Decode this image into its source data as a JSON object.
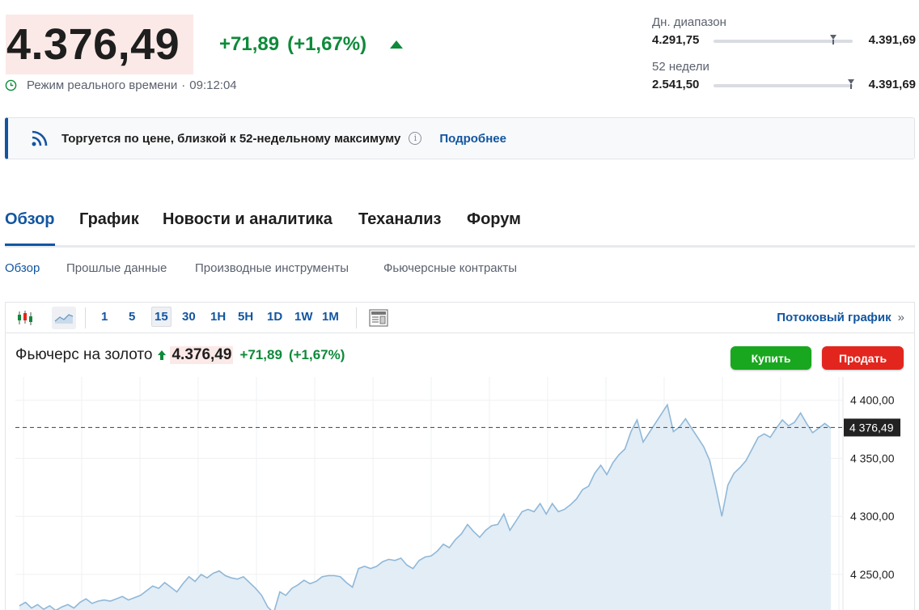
{
  "quote": {
    "price": "4.376,49",
    "change": "+71,89",
    "change_pct": "(+1,67%)",
    "realtime_label": "Режим реального времени",
    "separator": "·",
    "time": "09:12:04"
  },
  "ranges": {
    "day": {
      "label": "Дн. диапазон",
      "low": "4.291,75",
      "high": "4.391,69",
      "position": 0.86
    },
    "week52": {
      "label": "52 недели",
      "low": "2.541,50",
      "high": "4.391,69",
      "position": 0.99
    }
  },
  "alert": {
    "message": "Торгуется по цене, близкой к 52-недельному максимуму",
    "info_icon": "info-icon",
    "link": "Подробнее"
  },
  "tabs": [
    {
      "label": "Обзор",
      "active": true
    },
    {
      "label": "График",
      "active": false
    },
    {
      "label": "Новости и аналитика",
      "active": false
    },
    {
      "label": "Теханализ",
      "active": false
    },
    {
      "label": "Форум",
      "active": false
    }
  ],
  "subtabs": [
    {
      "label": "Обзор",
      "active": true
    },
    {
      "label": "Прошлые данные",
      "active": false
    },
    {
      "label": "Производные инструменты",
      "active": false
    },
    {
      "label": "Фьючерсные контракты",
      "active": false
    }
  ],
  "toolbar": {
    "timeframes": [
      "1",
      "5",
      "15",
      "30",
      "1H",
      "5H",
      "1D",
      "1W",
      "1M"
    ],
    "selected_timeframe": "15",
    "stream_link": "Потоковый график",
    "stream_arrow": "»"
  },
  "instrument": {
    "name": "Фьючерс на золото",
    "price": "4.376,49",
    "change": "+71,89",
    "change_pct": "(+1,67%)"
  },
  "buttons": {
    "buy": "Купить",
    "sell": "Продать"
  },
  "colors": {
    "up": "#0e8a3a",
    "link": "#1256a0",
    "buy": "#19a71f",
    "sell": "#e2261e",
    "price_highlight": "#fbe9e7",
    "line": "#8fb8d8",
    "area": "#e3edf6"
  },
  "chart_data": {
    "type": "area",
    "y_ticks": [
      "4 400,00",
      "4 350,00",
      "4 300,00",
      "4 250,00"
    ],
    "y_tick_values": [
      4400,
      4350,
      4300,
      4250
    ],
    "last_price_label": "4 376,49",
    "last_price": 4376.49,
    "ylim": [
      4211,
      4420
    ],
    "grid": true,
    "values": [
      4223,
      4226,
      4221,
      4224,
      4220,
      4223,
      4219,
      4222,
      4224,
      4221,
      4226,
      4229,
      4225,
      4227,
      4228,
      4227,
      4229,
      4231,
      4228,
      4230,
      4232,
      4236,
      4240,
      4238,
      4243,
      4239,
      4235,
      4242,
      4248,
      4244,
      4250,
      4247,
      4251,
      4253,
      4249,
      4247,
      4246,
      4248,
      4243,
      4238,
      4232,
      4222,
      4217,
      4235,
      4232,
      4238,
      4241,
      4245,
      4242,
      4244,
      4248,
      4249,
      4249,
      4248,
      4243,
      4239,
      4255,
      4257,
      4255,
      4257,
      4261,
      4263,
      4262,
      4264,
      4258,
      4255,
      4262,
      4265,
      4266,
      4270,
      4276,
      4273,
      4280,
      4285,
      4293,
      4287,
      4282,
      4288,
      4292,
      4293,
      4302,
      4288,
      4296,
      4304,
      4306,
      4304,
      4311,
      4302,
      4311,
      4304,
      4306,
      4310,
      4315,
      4323,
      4326,
      4337,
      4344,
      4336,
      4346,
      4353,
      4358,
      4373,
      4383,
      4364,
      4372,
      4380,
      4388,
      4396,
      4373,
      4377,
      4384,
      4376,
      4368,
      4360,
      4348,
      4325,
      4300,
      4327,
      4337,
      4342,
      4348,
      4358,
      4368,
      4371,
      4368,
      4376,
      4383,
      4378,
      4381,
      4389,
      4380,
      4372,
      4376,
      4380,
      4376
    ]
  }
}
